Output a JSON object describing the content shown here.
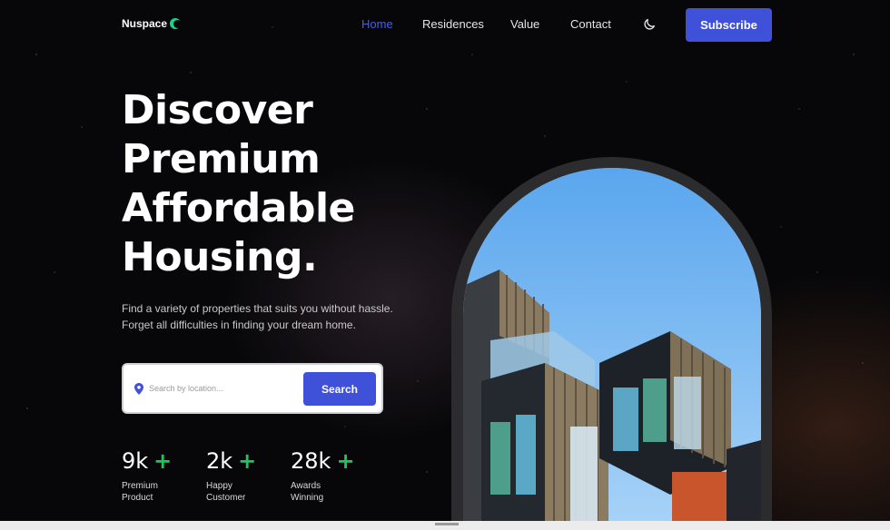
{
  "nav": {
    "logo": "Nuspace",
    "links": [
      "Home",
      "Residences",
      "Value",
      "Contact"
    ],
    "active": "Home",
    "subscribe_label": "Subscribe",
    "theme_icon": "moon-icon"
  },
  "hero": {
    "title_lines": [
      "Discover",
      "Premium",
      "Affordable",
      "Housing."
    ],
    "description_lines": [
      "Find a variety of properties that suits you without hassle.",
      "Forget all difficulties in finding your dream home."
    ],
    "search": {
      "placeholder": "Search by location...",
      "value": "",
      "button_label": "Search",
      "icon": "location-pin-icon"
    },
    "stats": [
      {
        "value": "9k",
        "plus": "+",
        "label_lines": [
          "Premium",
          "Product"
        ]
      },
      {
        "value": "2k",
        "plus": "+",
        "label_lines": [
          "Happy",
          "Customer"
        ]
      },
      {
        "value": "28k",
        "plus": "+",
        "label_lines": [
          "Awards",
          "Winning"
        ]
      }
    ]
  },
  "colors": {
    "background": "#070709",
    "accent": "#3f51d9",
    "active_link": "#4a5ee3",
    "plus": "#1fc45b",
    "logo_mark": "#19d38c"
  }
}
